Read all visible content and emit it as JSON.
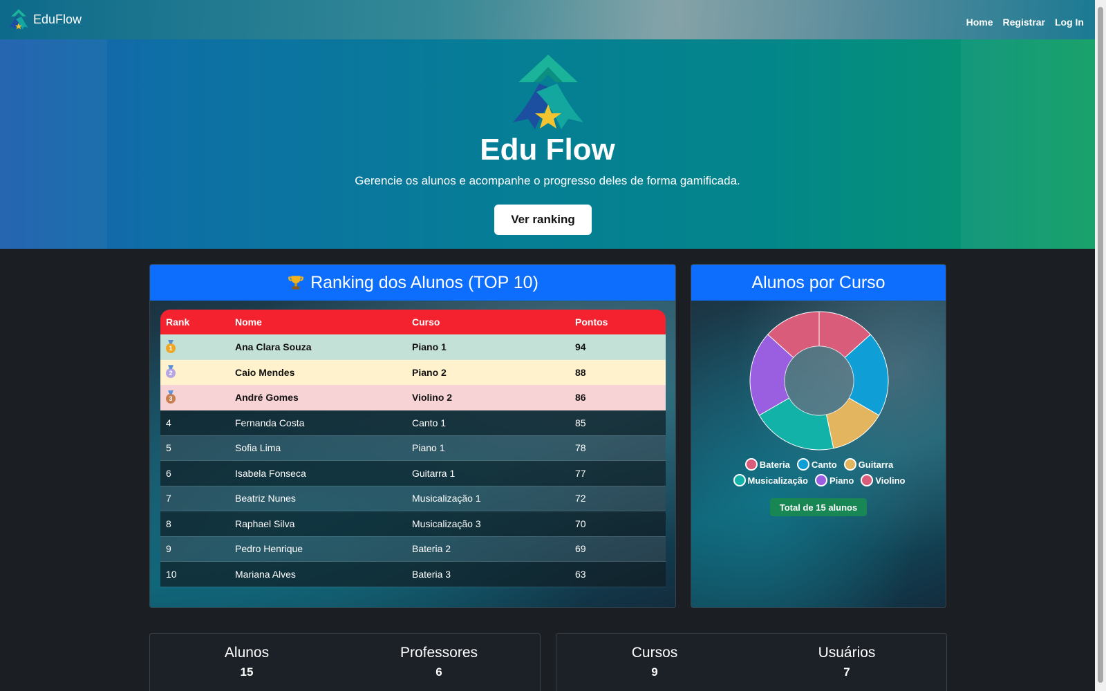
{
  "navbar": {
    "brand": "EduFlow",
    "links": [
      "Home",
      "Registrar",
      "Log In"
    ]
  },
  "hero": {
    "title": "Edu Flow",
    "subtitle": "Gerencie os alunos e acompanhe o progresso deles de forma gamificada.",
    "button": "Ver ranking"
  },
  "ranking": {
    "title": "Ranking dos Alunos (TOP 10)",
    "title_icon": "trophy-icon",
    "columns": [
      "Rank",
      "Nome",
      "Curso",
      "Pontos"
    ],
    "rows": [
      {
        "rank": "",
        "medal": "gold-medal-icon",
        "name": "Ana Clara Souza",
        "course": "Piano 1",
        "points": "94"
      },
      {
        "rank": "",
        "medal": "silver-medal-icon",
        "name": "Caio Mendes",
        "course": "Piano 2",
        "points": "88"
      },
      {
        "rank": "",
        "medal": "bronze-medal-icon",
        "name": "André Gomes",
        "course": "Violino 2",
        "points": "86"
      },
      {
        "rank": "4",
        "name": "Fernanda Costa",
        "course": "Canto 1",
        "points": "85"
      },
      {
        "rank": "5",
        "name": "Sofia Lima",
        "course": "Piano 1",
        "points": "78"
      },
      {
        "rank": "6",
        "name": "Isabela Fonseca",
        "course": "Guitarra 1",
        "points": "77"
      },
      {
        "rank": "7",
        "name": "Beatriz Nunes",
        "course": "Musicalização 1",
        "points": "72"
      },
      {
        "rank": "8",
        "name": "Raphael Silva",
        "course": "Musicalização 3",
        "points": "70"
      },
      {
        "rank": "9",
        "name": "Pedro Henrique",
        "course": "Bateria 2",
        "points": "69"
      },
      {
        "rank": "10",
        "name": "Mariana Alves",
        "course": "Bateria 3",
        "points": "63"
      }
    ]
  },
  "chart_card": {
    "title": "Alunos por Curso",
    "total_badge": "Total de 15 alunos"
  },
  "chart_data": {
    "type": "pie",
    "donut": true,
    "categories": [
      "Bateria",
      "Canto",
      "Guitarra",
      "Musicalização",
      "Piano",
      "Violino"
    ],
    "values": [
      2,
      3,
      2,
      3,
      3,
      2
    ],
    "colors": [
      "#d95d7a",
      "#0f9ed6",
      "#e2b55e",
      "#13b2a8",
      "#9a5fe0",
      "#d95d7a"
    ],
    "legend_placement": "bottom"
  },
  "stats": [
    {
      "label": "Alunos",
      "value": "15"
    },
    {
      "label": "Professores",
      "value": "6"
    },
    {
      "label": "Cursos",
      "value": "9"
    },
    {
      "label": "Usuários",
      "value": "7"
    }
  ]
}
